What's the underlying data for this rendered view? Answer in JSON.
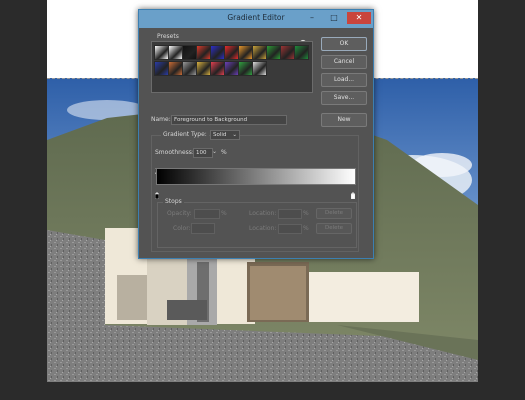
{
  "dialog": {
    "title": "Gradient Editor",
    "minimize_glyph": "–",
    "maximize_glyph": "□",
    "close_glyph": "✕"
  },
  "presets": {
    "label": "Presets",
    "menu_icon": "gear-icon",
    "swatches_row1": [
      "#ffffff",
      "#ffffff",
      "#111111",
      "#d83a2a",
      "#2c2ec8",
      "#e52a2a",
      "#e8962a",
      "#caa43b",
      "#2c9a35",
      "#9c3434",
      "#1e8a3a"
    ],
    "swatches_row2": [
      "#2a3ca8",
      "#c96c35",
      "#999999",
      "#d8b040",
      "#e04050",
      "#6a40b8",
      "#30a040",
      "#dddddd"
    ]
  },
  "buttons": {
    "ok": "OK",
    "cancel": "Cancel",
    "load": "Load...",
    "save": "Save...",
    "new": "New"
  },
  "name_field": {
    "label": "Name:",
    "value": "Foreground to Background"
  },
  "gradient_type": {
    "label": "Gradient Type:",
    "value": "Solid"
  },
  "smoothness": {
    "label": "Smoothness:",
    "value": "100",
    "unit": "%"
  },
  "stops": {
    "label": "Stops",
    "opacity_label": "Opacity:",
    "opacity_unit": "%",
    "location_label": "Location:",
    "location_unit": "%",
    "delete": "Delete",
    "color_label": "Color:"
  },
  "colors": {
    "dialog_bg": "#535353",
    "titlebar": "#6aa0c9",
    "close": "#c9453d",
    "sky": "#3f74b9",
    "hill": "#6c7559",
    "concrete": "#808080"
  }
}
